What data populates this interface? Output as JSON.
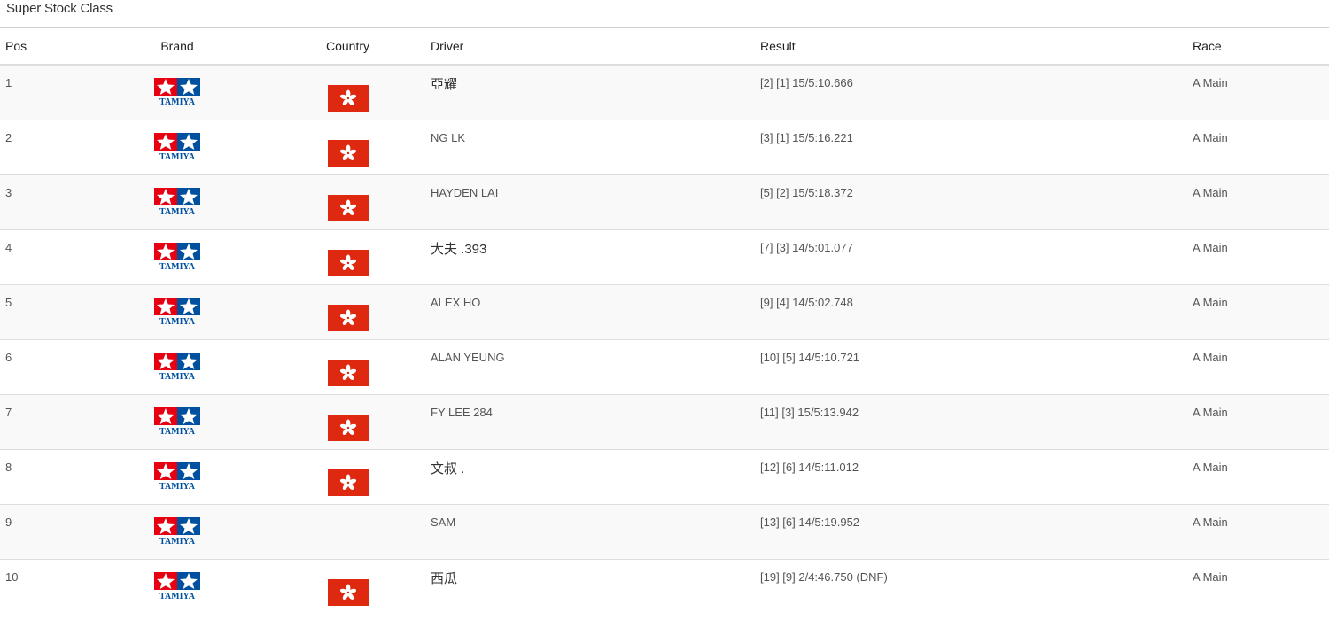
{
  "class_title": "Super Stock Class",
  "columns": {
    "pos": "Pos",
    "brand": "Brand",
    "country": "Country",
    "driver": "Driver",
    "result": "Result",
    "race": "Race"
  },
  "brand_logo_text": "TAMIYA",
  "icons": {
    "brand": "tamiya-logo-icon",
    "country": "hong-kong-flag-icon"
  },
  "colors": {
    "flag_red": "#de2910",
    "tamiya_red": "#e60012",
    "tamiya_blue": "#0050a0"
  },
  "rows": [
    {
      "pos": "1",
      "driver": "亞耀",
      "result": "[2] [1] 15/5:10.666",
      "race": "A Main",
      "has_flag": true
    },
    {
      "pos": "2",
      "driver": "NG LK",
      "result": "[3] [1] 15/5:16.221",
      "race": "A Main",
      "has_flag": true
    },
    {
      "pos": "3",
      "driver": "HAYDEN LAI",
      "result": "[5] [2] 15/5:18.372",
      "race": "A Main",
      "has_flag": true
    },
    {
      "pos": "4",
      "driver": "大夫 .393",
      "result": "[7] [3] 14/5:01.077",
      "race": "A Main",
      "has_flag": true
    },
    {
      "pos": "5",
      "driver": "ALEX HO",
      "result": "[9] [4] 14/5:02.748",
      "race": "A Main",
      "has_flag": true
    },
    {
      "pos": "6",
      "driver": "ALAN YEUNG",
      "result": "[10] [5] 14/5:10.721",
      "race": "A Main",
      "has_flag": true
    },
    {
      "pos": "7",
      "driver": "FY LEE 284",
      "result": "[11] [3] 15/5:13.942",
      "race": "A Main",
      "has_flag": true
    },
    {
      "pos": "8",
      "driver": "文叔 .",
      "result": "[12] [6] 14/5:11.012",
      "race": "A Main",
      "has_flag": true
    },
    {
      "pos": "9",
      "driver": "SAM",
      "result": "[13] [6] 14/5:19.952",
      "race": "A Main",
      "has_flag": false
    },
    {
      "pos": "10",
      "driver": "西瓜",
      "result": "[19] [9] 2/4:46.750 (DNF)",
      "race": "A Main",
      "has_flag": true
    }
  ]
}
